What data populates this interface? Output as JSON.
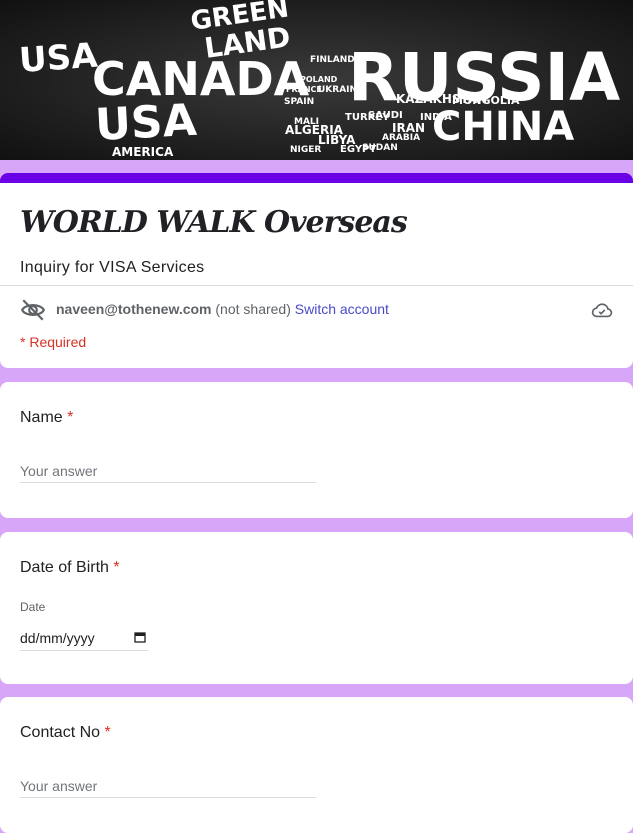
{
  "banner": {
    "words": [
      "USA",
      "CANADA",
      "USA",
      "GREEN",
      "LAND",
      "RUSSIA",
      "CHINA",
      "KAZAKHSTAN",
      "MONGOLIA",
      "TURKEY",
      "IRAN",
      "ALGERIA",
      "LIBYA",
      "EGYPT",
      "SAUDI",
      "NIGER",
      "SUDAN",
      "ARABIA",
      "FINLAND",
      "UKRAINE",
      "POLAND",
      "SPAIN",
      "FRANCE",
      "MALI",
      "INDIA",
      "AMERICA"
    ]
  },
  "header": {
    "title": "WORLD WALK Overseas",
    "description": "Inquiry for VISA Services",
    "account_email": "naveen@tothenew.com",
    "not_shared": "(not shared)",
    "switch_account": "Switch account",
    "required_note": "* Required"
  },
  "questions": [
    {
      "label": "Name",
      "required_mark": "*",
      "placeholder": "Your answer"
    },
    {
      "label": "Date of Birth",
      "required_mark": "*",
      "caption": "Date",
      "value": "dd/mm/yyyy"
    },
    {
      "label": "Contact No",
      "required_mark": "*",
      "placeholder": "Your answer"
    }
  ],
  "colors": {
    "page_background": "#d7a6f9",
    "header_accent": "#6a00e6",
    "required": "#d93025",
    "link": "#4a4ac9"
  },
  "icons": [
    "eye-off-icon",
    "cloud-saved-icon",
    "calendar-icon"
  ]
}
